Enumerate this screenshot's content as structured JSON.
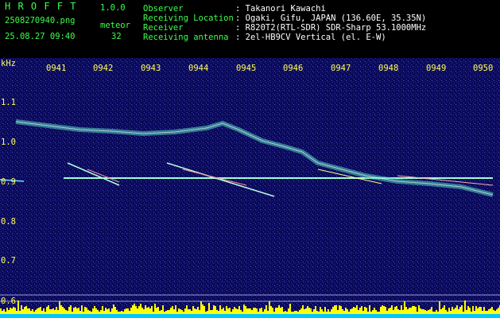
{
  "app": {
    "logo": "H R O F F T",
    "version": "1.0.0"
  },
  "file": {
    "name": "2508270940.png",
    "datetime": "25.08.27 09:40"
  },
  "meteor": {
    "label": "meteor",
    "count": "32"
  },
  "info": [
    {
      "label": "Observer",
      "value": ": Takanori Kawachi"
    },
    {
      "label": "Receiving Location",
      "value": ": Ogaki, Gifu, JAPAN (136.60E, 35.35N)"
    },
    {
      "label": "Receiver",
      "value": ": R820T2(RTL-SDR) SDR-Sharp 53.1000MHz"
    },
    {
      "label": "Receiving antenna",
      "value": ": 2el-HB9CV Vertical (el. E-W)"
    }
  ],
  "axis": {
    "unit": "kHz",
    "x_ticks": [
      "0941",
      "0942",
      "0943",
      "0944",
      "0945",
      "0946",
      "0947",
      "0948",
      "0949",
      "0950"
    ],
    "y_ticks": [
      "1.1",
      "1.0",
      "0.9",
      "0.8",
      "0.7",
      "0.6"
    ]
  },
  "colors": {
    "background": "#0a0a5a",
    "header_text_green": "#3cff4a",
    "axis_text_yellow": "#ffff55",
    "signal_line": "#9fffcf",
    "noise_bars": "#ffff00",
    "bottom_strip": "#00c8ff"
  }
}
